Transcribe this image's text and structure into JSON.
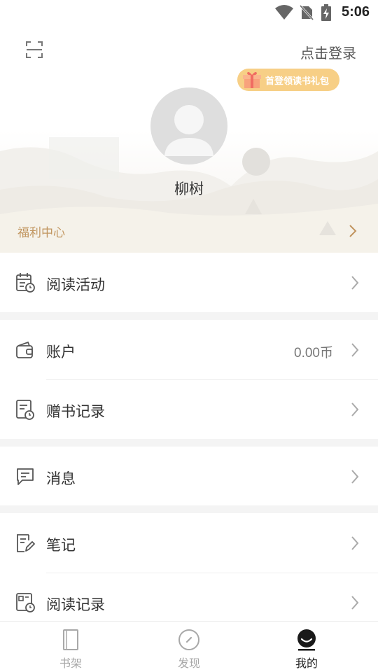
{
  "status_bar": {
    "time": "5:06",
    "icons": [
      "wifi-icon",
      "no-sim-icon",
      "battery-charging-icon"
    ]
  },
  "header": {
    "scan_icon": "scan-icon",
    "login_link": "点击登录",
    "gift_badge": "首登领读书礼包",
    "username": "柳树",
    "welfare_label": "福利中心"
  },
  "menu": {
    "reading_activity": {
      "label": "阅读活动",
      "icon": "calendar-clock-icon"
    },
    "account": {
      "label": "账户",
      "value": "0.00币",
      "icon": "wallet-icon"
    },
    "gift_records": {
      "label": "赠书记录",
      "icon": "document-clock-icon"
    },
    "messages": {
      "label": "消息",
      "icon": "message-icon"
    },
    "notes": {
      "label": "笔记",
      "icon": "note-pencil-icon"
    },
    "reading_history": {
      "label": "阅读记录",
      "icon": "book-clock-icon"
    }
  },
  "bottom_nav": {
    "bookshelf": "书架",
    "discover": "发现",
    "mine": "我的",
    "active": "我的"
  },
  "colors": {
    "accent_gold": "#c1955f",
    "badge_bg": "#f7cf86",
    "gap_gray": "#f4f4f4"
  }
}
